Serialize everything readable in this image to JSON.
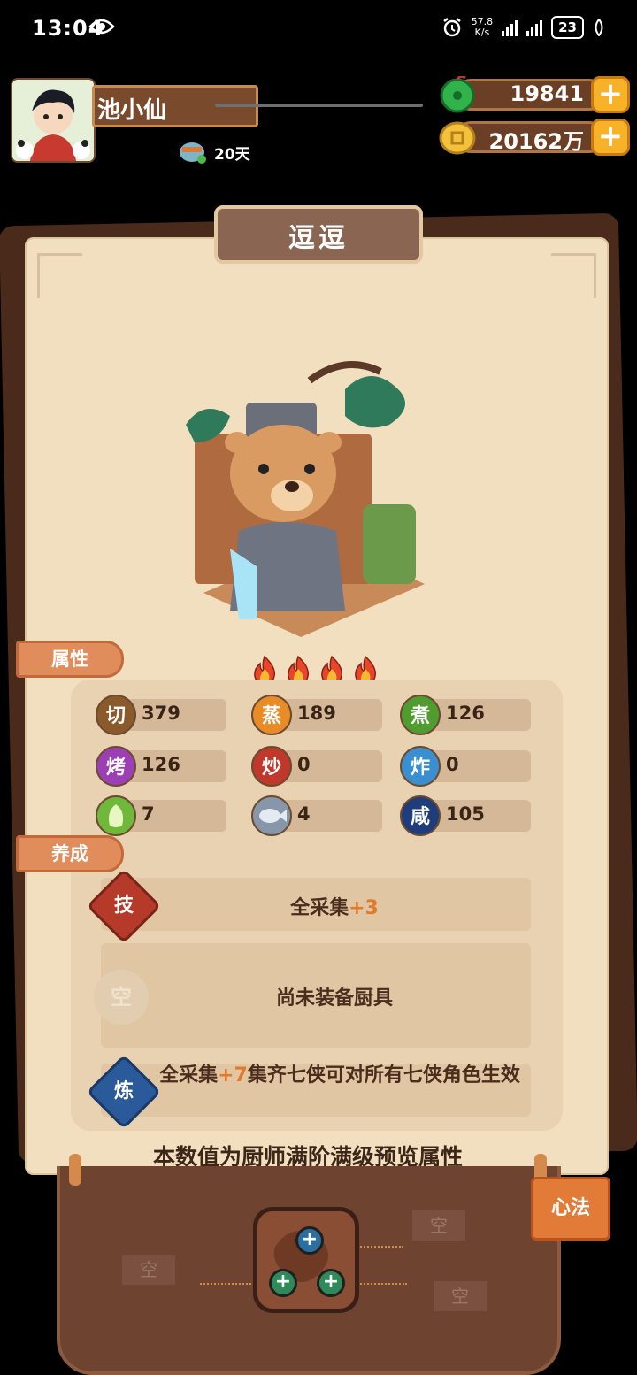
{
  "status_bar": {
    "time": "13:04",
    "net_speed_value": "57.8",
    "net_speed_unit": "K/s",
    "battery": "23"
  },
  "player": {
    "name": "池小仙",
    "days": "20天"
  },
  "resources": {
    "jade": "19841",
    "coins": "20162万"
  },
  "character": {
    "name": "逗逗",
    "stars": 4
  },
  "sections": {
    "attributes": "属性",
    "cultivation": "养成"
  },
  "attributes": [
    {
      "label": "切",
      "value": "379",
      "color": "#8a5a2b"
    },
    {
      "label": "蒸",
      "value": "189",
      "color": "#e98b26"
    },
    {
      "label": "煮",
      "value": "126",
      "color": "#4f9d2f"
    },
    {
      "label": "烤",
      "value": "126",
      "color": "#9c3fb5"
    },
    {
      "label": "炒",
      "value": "0",
      "color": "#c0382b"
    },
    {
      "label": "炸",
      "value": "0",
      "color": "#3a8fd0"
    },
    {
      "label": "",
      "value": "7",
      "color": "#6fb83a",
      "icon": "vegetable-icon"
    },
    {
      "label": "",
      "value": "4",
      "color": "#8796a8",
      "icon": "fish-icon"
    },
    {
      "label": "咸",
      "value": "105",
      "color": "#1f3d7a"
    }
  ],
  "cultivation": {
    "skill_icon": "技",
    "skill_text": "全采集",
    "skill_bonus": "+3",
    "equip_icon": "空",
    "equip_text": "尚未装备厨具",
    "refine_icon": "炼",
    "refine_prefix": "全采集",
    "refine_bonus": "+7",
    "refine_suffix": "集齐七侠可对所有七侠角色生效"
  },
  "preview_note": "本数值为厨师满阶满级预览属性",
  "xinfa_button": "心法",
  "empty_slot_label": "空",
  "colors": {
    "accent": "#e07a2d",
    "card": "#f2dfc0",
    "frame": "#6e4330"
  }
}
